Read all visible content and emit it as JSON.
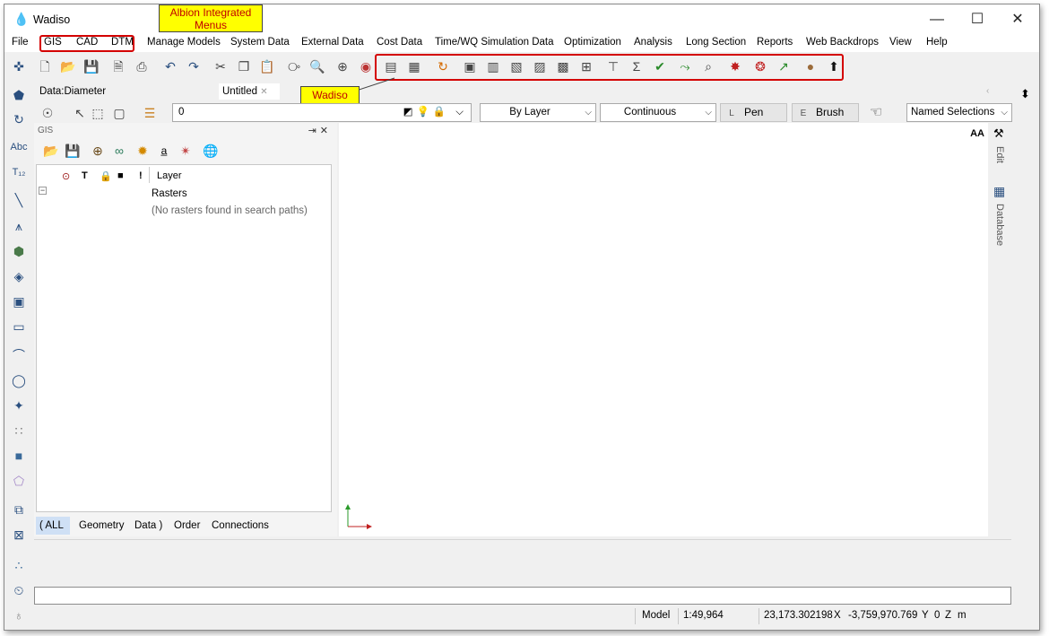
{
  "window": {
    "title": "Wadiso"
  },
  "menus": [
    "File",
    "GIS",
    "CAD",
    "DTM",
    "Manage Models",
    "System Data",
    "External Data",
    "Cost Data",
    "Time/WQ Simulation Data",
    "Optimization",
    "Analysis",
    "Long Section",
    "Reports",
    "Web Backdrops",
    "View",
    "Help"
  ],
  "annotations": {
    "menus_callout": "Albion Integrated Menus",
    "icons_callout": "Wadiso Icons"
  },
  "tabs": {
    "data_tab": "Data:Diameter",
    "doc_tab": "Untitled"
  },
  "properties": {
    "layer_value": "0",
    "color_dropdown": "By Layer",
    "linetype_dropdown": "Continuous",
    "pen_key": "L",
    "pen_label": "Pen",
    "brush_key": "E",
    "brush_label": "Brush",
    "named_selections": "Named Selections"
  },
  "gis_panel": {
    "title": "GIS",
    "column_header": "Layer",
    "group_label": "Rasters",
    "empty_message": "(No rasters found in search paths)",
    "bottom_tabs": [
      "( ALL",
      "Geometry",
      "Data )",
      "Order",
      "Connections"
    ]
  },
  "right_rail": {
    "edit_label": "Edit",
    "database_label": "Database",
    "font_size_label": "AA"
  },
  "status": {
    "mode": "Model",
    "scale": "1:49,964",
    "x_value": "23,173.302198",
    "x_label": "X",
    "y_value": "-3,759,970.769",
    "y_label": "Y",
    "z_value": "0",
    "z_label": "Z",
    "unit": "m"
  },
  "colors": {
    "accent": "#2b6cd8",
    "callout_bg": "#ffff00",
    "callout_text": "#c00000",
    "highlight_border": "#d40000"
  }
}
